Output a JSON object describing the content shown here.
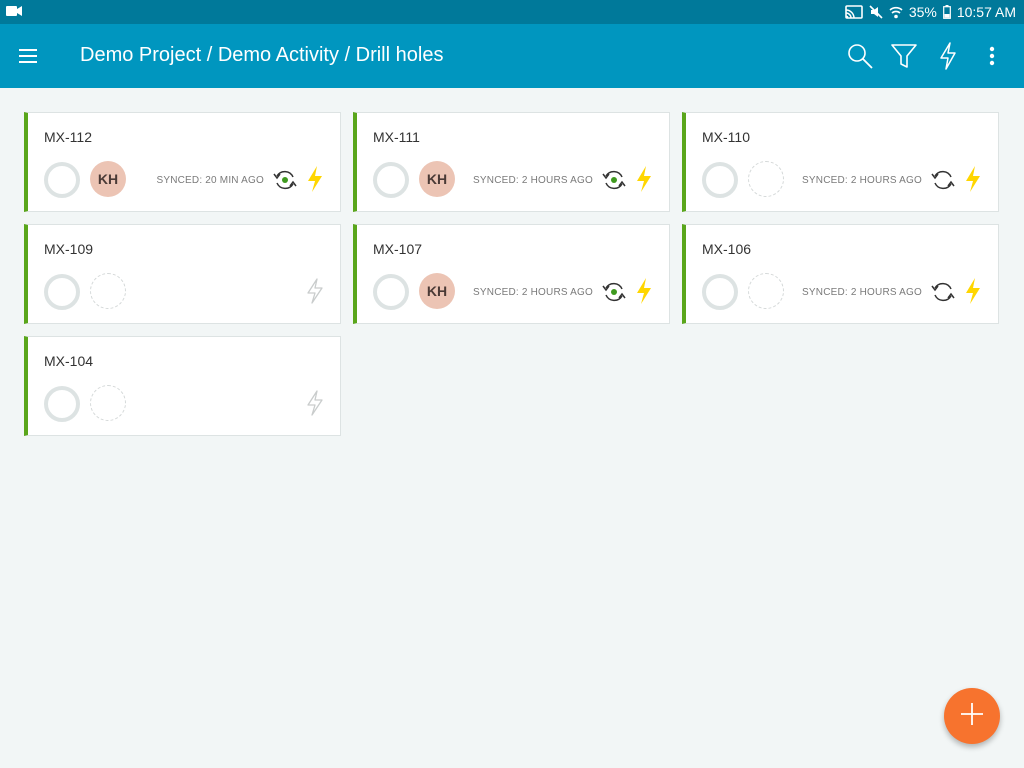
{
  "status_bar": {
    "battery": "35%",
    "time": "10:57 AM"
  },
  "app_bar": {
    "title": "Demo Project / Demo Activity / Drill holes",
    "icons": [
      "menu-icon",
      "search-icon",
      "filter-icon",
      "flash-icon",
      "more-vert-icon"
    ]
  },
  "colors": {
    "app_bar": "#0096bf",
    "status_bar": "#00799a",
    "card_accent": "#5aa61b",
    "bolt_active": "#ffd600",
    "bolt_inactive": "#c9cccc",
    "fab": "#f7732e",
    "avatar": "#ecc4b4"
  },
  "cards": [
    {
      "id": "MX-112",
      "assignee": "KH",
      "synced": "SYNCED: 20 MIN AGO",
      "sync_icon": "sync-with-green-dot-icon",
      "bolt": "active"
    },
    {
      "id": "MX-111",
      "assignee": "KH",
      "synced": "SYNCED: 2 HOURS AGO",
      "sync_icon": "sync-with-green-dot-icon",
      "bolt": "active"
    },
    {
      "id": "MX-110",
      "assignee": "",
      "synced": "SYNCED: 2 HOURS AGO",
      "sync_icon": "sync-icon",
      "bolt": "active"
    },
    {
      "id": "MX-109",
      "assignee": "",
      "synced": "",
      "sync_icon": "",
      "bolt": "inactive"
    },
    {
      "id": "MX-107",
      "assignee": "KH",
      "synced": "SYNCED: 2 HOURS AGO",
      "sync_icon": "sync-with-green-dot-icon",
      "bolt": "active"
    },
    {
      "id": "MX-106",
      "assignee": "",
      "synced": "SYNCED: 2 HOURS AGO",
      "sync_icon": "sync-icon",
      "bolt": "active"
    },
    {
      "id": "MX-104",
      "assignee": "",
      "synced": "",
      "sync_icon": "",
      "bolt": "inactive"
    }
  ],
  "fab": {
    "icon": "add-icon"
  }
}
